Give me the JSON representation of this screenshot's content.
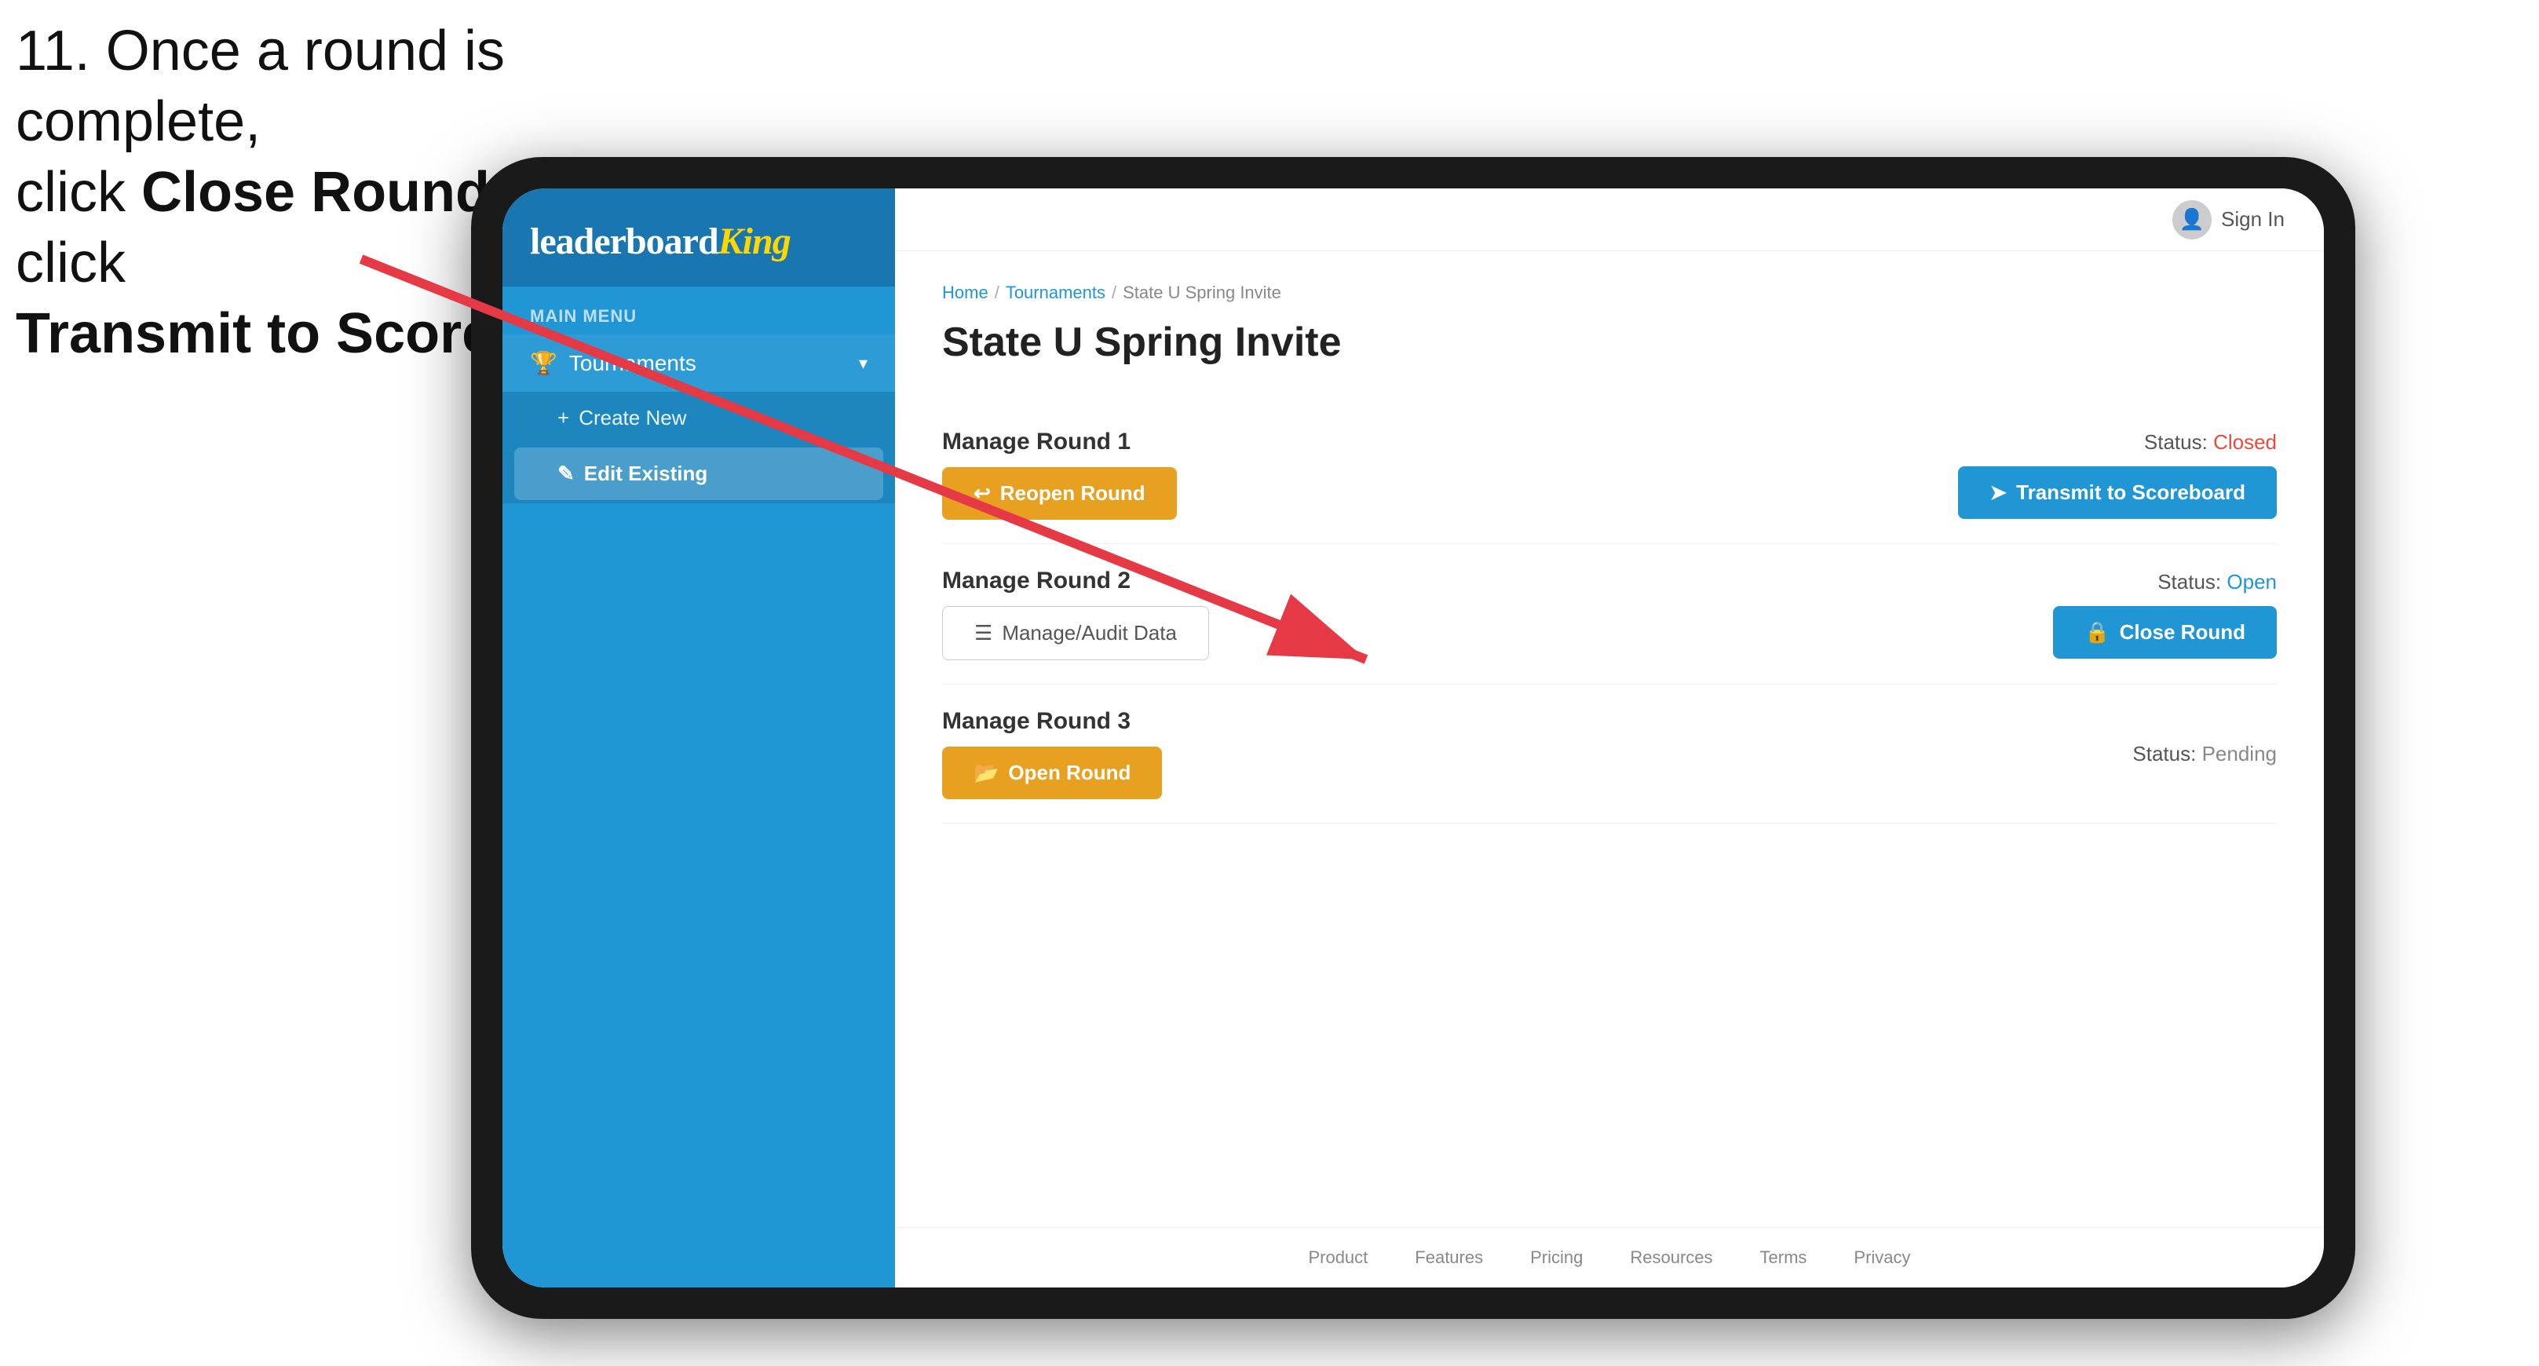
{
  "instruction": {
    "line1": "11. Once a round is complete,",
    "line2_prefix": "click ",
    "line2_bold": "Close Round",
    "line2_suffix": " then click",
    "line3_bold": "Transmit to Scoreboard."
  },
  "sidebar": {
    "logo_leader": "leaderboard",
    "logo_king": "King",
    "main_menu_label": "MAIN MENU",
    "menu_items": [
      {
        "id": "tournaments",
        "label": "Tournaments",
        "icon": "🏆",
        "expanded": true
      }
    ],
    "submenu_items": [
      {
        "id": "create-new",
        "label": "Create New",
        "icon": "+"
      },
      {
        "id": "edit-existing",
        "label": "Edit Existing",
        "icon": "✎",
        "active": true
      }
    ]
  },
  "topnav": {
    "sign_in_label": "Sign In"
  },
  "breadcrumb": {
    "home": "Home",
    "sep1": "/",
    "tournaments": "Tournaments",
    "sep2": "/",
    "current": "State U Spring Invite"
  },
  "page": {
    "title": "State U Spring Invite",
    "rounds": [
      {
        "id": "round1",
        "label": "Manage Round 1",
        "status_label": "Status:",
        "status_value": "Closed",
        "status_class": "status-closed",
        "left_button": {
          "label": "Reopen Round",
          "icon": "↩",
          "style": "btn-orange"
        },
        "right_button": {
          "label": "Transmit to Scoreboard",
          "icon": "➤",
          "style": "btn-blue"
        }
      },
      {
        "id": "round2",
        "label": "Manage Round 2",
        "status_label": "Status:",
        "status_value": "Open",
        "status_class": "status-open",
        "left_button": {
          "label": "Manage/Audit Data",
          "icon": "☰",
          "style": "btn-outline"
        },
        "right_button": {
          "label": "Close Round",
          "icon": "🔒",
          "style": "btn-blue"
        }
      },
      {
        "id": "round3",
        "label": "Manage Round 3",
        "status_label": "Status:",
        "status_value": "Pending",
        "status_class": "status-pending",
        "left_button": {
          "label": "Open Round",
          "icon": "📂",
          "style": "btn-orange"
        },
        "right_button": null
      }
    ]
  },
  "footer": {
    "links": [
      "Product",
      "Features",
      "Pricing",
      "Resources",
      "Terms",
      "Privacy"
    ]
  }
}
